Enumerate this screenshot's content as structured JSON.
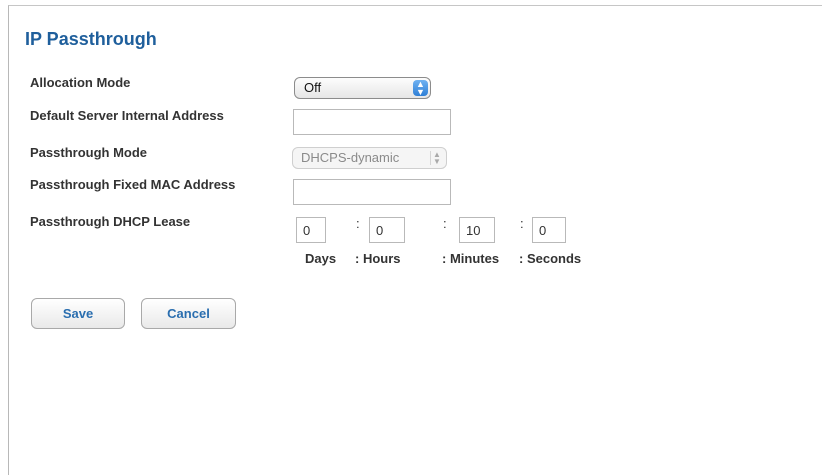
{
  "page_title": "IP Passthrough",
  "labels": {
    "allocation_mode": "Allocation Mode",
    "default_server": "Default Server Internal Address",
    "passthrough_mode": "Passthrough Mode",
    "fixed_mac": "Passthrough Fixed MAC Address",
    "dhcp_lease": "Passthrough DHCP Lease"
  },
  "fields": {
    "allocation_mode_value": "Off",
    "default_server_value": "",
    "passthrough_mode_value": "DHCPS-dynamic",
    "fixed_mac_value": "",
    "lease_days": "0",
    "lease_hours": "0",
    "lease_minutes": "10",
    "lease_seconds": "0"
  },
  "lease_units": {
    "days": "Days",
    "hours": ": Hours",
    "minutes": ": Minutes",
    "seconds": ": Seconds"
  },
  "colon": ":",
  "buttons": {
    "save": "Save",
    "cancel": "Cancel"
  },
  "colors": {
    "title": "#1f5f9c",
    "button_text": "#2a6eaf",
    "select_arrow": "#2f7fd6"
  }
}
